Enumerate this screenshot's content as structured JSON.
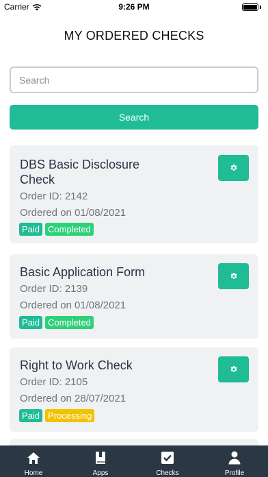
{
  "status_bar": {
    "carrier": "Carrier",
    "time": "9:26 PM"
  },
  "page": {
    "title": "MY ORDERED CHECKS"
  },
  "search": {
    "placeholder": "Search",
    "value": "",
    "button_label": "Search"
  },
  "orders": [
    {
      "title": "DBS Basic Disclosure Check",
      "order_id": "Order ID: 2142",
      "ordered_on": "Ordered on 01/08/2021",
      "payment_status": "Paid",
      "check_status": "Completed"
    },
    {
      "title": "Basic Application Form",
      "order_id": "Order ID: 2139",
      "ordered_on": "Ordered on 01/08/2021",
      "payment_status": "Paid",
      "check_status": "Completed"
    },
    {
      "title": "Right to Work Check",
      "order_id": "Order ID: 2105",
      "ordered_on": "Ordered on 28/07/2021",
      "payment_status": "Paid",
      "check_status": "Processing"
    }
  ],
  "tabs": [
    {
      "label": "Home",
      "icon": "home-icon"
    },
    {
      "label": "Apps",
      "icon": "book-icon"
    },
    {
      "label": "Checks",
      "icon": "checkbox-icon"
    },
    {
      "label": "Profile",
      "icon": "user-icon"
    }
  ],
  "colors": {
    "accent": "#1fbc96",
    "completed": "#2fd07a",
    "processing": "#f2c200",
    "tab_bar": "#2c3744"
  }
}
